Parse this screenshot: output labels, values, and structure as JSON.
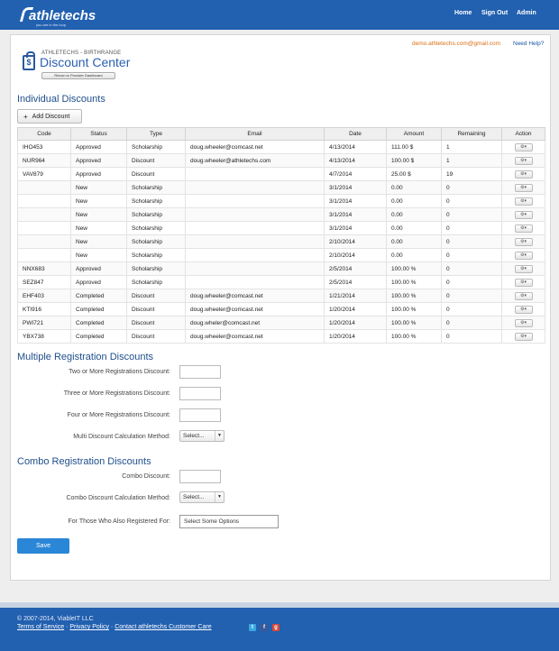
{
  "header": {
    "logo_text": "athletechs",
    "logo_tagline": "you are in the loop",
    "nav": [
      "Home",
      "Sign Out",
      "Admin"
    ]
  },
  "account": {
    "email": "demo.athletechs.com@gmail.com",
    "help": "Need Help?"
  },
  "discount_center": {
    "subtitle": "ATHLETECHS - BIRTHRANGE",
    "title": "Discount Center",
    "return_button": "Return to Provider Dashboard"
  },
  "individual": {
    "title": "Individual Discounts",
    "add_button": "Add Discount",
    "columns": [
      "Code",
      "Status",
      "Type",
      "Email",
      "Date",
      "Amount",
      "Remaining",
      "Action"
    ],
    "rows": [
      {
        "code": "IHO453",
        "status": "Approved",
        "type": "Scholarship",
        "email": "doug.wheeler@comcast.net",
        "date": "4/13/2014",
        "amount": "111.00 $",
        "remaining": "1"
      },
      {
        "code": "NUR964",
        "status": "Approved",
        "type": "Discount",
        "email": "doug.wheeler@athletechs.com",
        "date": "4/13/2014",
        "amount": "100.00 $",
        "remaining": "1"
      },
      {
        "code": "VAV879",
        "status": "Approved",
        "type": "Discount",
        "email": "",
        "date": "4/7/2014",
        "amount": "25.00 $",
        "remaining": "19"
      },
      {
        "code": "",
        "status": "New",
        "type": "Scholarship",
        "email": "",
        "date": "3/1/2014",
        "amount": "0.00",
        "remaining": "0"
      },
      {
        "code": "",
        "status": "New",
        "type": "Scholarship",
        "email": "",
        "date": "3/1/2014",
        "amount": "0.00",
        "remaining": "0"
      },
      {
        "code": "",
        "status": "New",
        "type": "Scholarship",
        "email": "",
        "date": "3/1/2014",
        "amount": "0.00",
        "remaining": "0"
      },
      {
        "code": "",
        "status": "New",
        "type": "Scholarship",
        "email": "",
        "date": "3/1/2014",
        "amount": "0.00",
        "remaining": "0"
      },
      {
        "code": "",
        "status": "New",
        "type": "Scholarship",
        "email": "",
        "date": "2/10/2014",
        "amount": "0.00",
        "remaining": "0"
      },
      {
        "code": "",
        "status": "New",
        "type": "Scholarship",
        "email": "",
        "date": "2/10/2014",
        "amount": "0.00",
        "remaining": "0"
      },
      {
        "code": "NNX683",
        "status": "Approved",
        "type": "Scholarship",
        "email": "",
        "date": "2/5/2014",
        "amount": "100.00 %",
        "remaining": "0"
      },
      {
        "code": "SEZ847",
        "status": "Approved",
        "type": "Scholarship",
        "email": "",
        "date": "2/5/2014",
        "amount": "100.00 %",
        "remaining": "0"
      },
      {
        "code": "EHF403",
        "status": "Completed",
        "type": "Discount",
        "email": "doug.wheeler@comcast.net",
        "date": "1/21/2014",
        "amount": "100.00 %",
        "remaining": "0"
      },
      {
        "code": "KTI916",
        "status": "Completed",
        "type": "Discount",
        "email": "doug.wheeler@comcast.net",
        "date": "1/20/2014",
        "amount": "100.00 %",
        "remaining": "0"
      },
      {
        "code": "PWI721",
        "status": "Completed",
        "type": "Discount",
        "email": "doug.wheler@comcast.net",
        "date": "1/20/2014",
        "amount": "100.00 %",
        "remaining": "0"
      },
      {
        "code": "YBX738",
        "status": "Completed",
        "type": "Discount",
        "email": "doug.wheeler@comcast.net",
        "date": "1/20/2014",
        "amount": "100.00 %",
        "remaining": "0"
      }
    ]
  },
  "multiple": {
    "title": "Multiple Registration Discounts",
    "two_label": "Two or More Registrations Discount:",
    "three_label": "Three or More Registrations Discount:",
    "four_label": "Four or More Registrations Discount:",
    "method_label": "Multi Discount Calculation Method:",
    "method_value": "Select..."
  },
  "combo": {
    "title": "Combo Registration Discounts",
    "discount_label": "Combo Discount:",
    "method_label": "Combo Discount Calculation Method:",
    "method_value": "Select...",
    "registered_label": "For Those Who Also Registered For:",
    "registered_placeholder": "Select Some Options"
  },
  "save_button": "Save",
  "footer": {
    "copyright": "© 2007-2014, ViableIT LLC",
    "links": [
      "Terms of Service",
      "Privacy Policy",
      "Contact athletechs Customer Care"
    ],
    "separator": "·"
  },
  "colors": {
    "brand": "#2260b0",
    "accent": "#2a86d6",
    "title": "#1f4e8c"
  }
}
